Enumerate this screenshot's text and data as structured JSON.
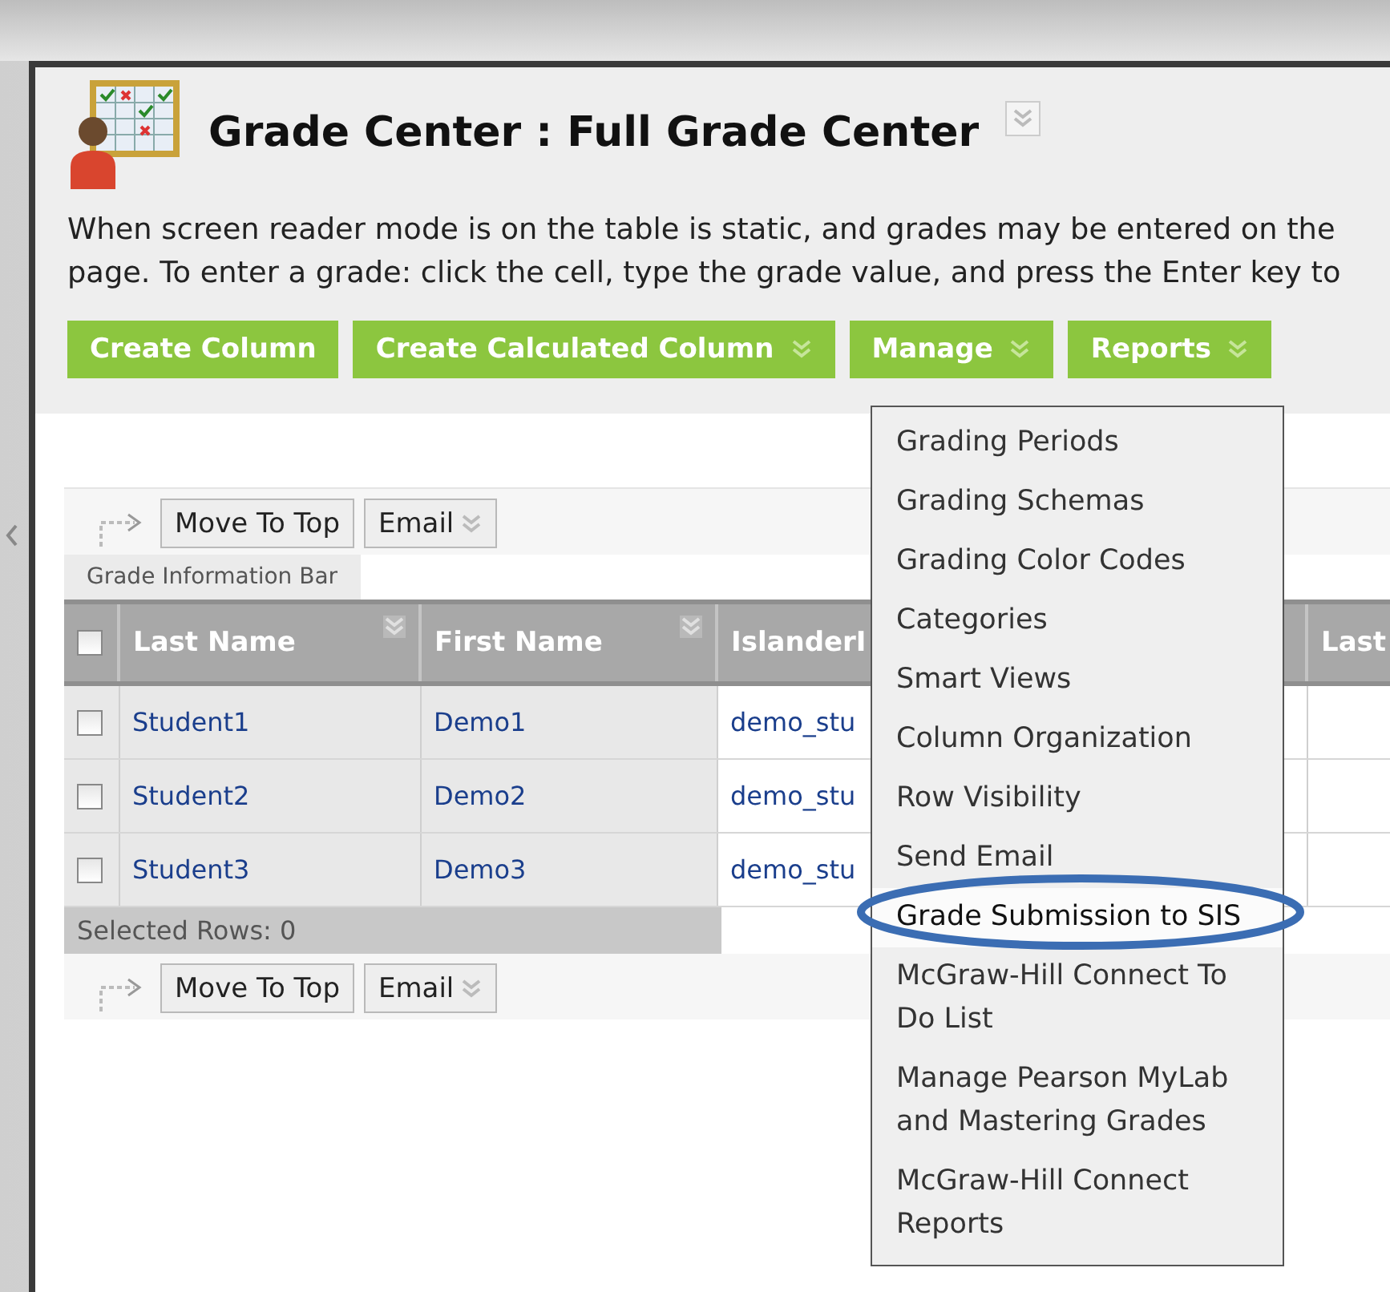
{
  "title": "Grade Center : Full Grade Center",
  "description": [
    "When screen reader mode is on the table is static, and grades may be entered on the",
    "page. To enter a grade: click the cell, type the grade value, and press the Enter key to"
  ],
  "action_buttons": [
    {
      "label": "Create Column",
      "has_menu": false
    },
    {
      "label": "Create Calculated Column",
      "has_menu": true
    },
    {
      "label": "Manage",
      "has_menu": true
    },
    {
      "label": "Reports",
      "has_menu": true
    }
  ],
  "top_actions": [
    {
      "label": "Move To Top",
      "has_menu": false
    },
    {
      "label": "Email",
      "has_menu": true
    }
  ],
  "info_bar": "Grade Information Bar",
  "table": {
    "select_all": {
      "checked": false
    },
    "columns": [
      {
        "label": "Last Name",
        "has_menu": true
      },
      {
        "label": "First Name",
        "has_menu": true
      },
      {
        "label": "IslanderI",
        "has_menu": false
      },
      {
        "label": "Last",
        "has_menu": false
      }
    ],
    "rows": [
      {
        "checked": false,
        "last_name": "Student1",
        "first_name": "Demo1",
        "islander_id": "demo_stu"
      },
      {
        "checked": false,
        "last_name": "Student2",
        "first_name": "Demo2",
        "islander_id": "demo_stu"
      },
      {
        "checked": false,
        "last_name": "Student3",
        "first_name": "Demo3",
        "islander_id": "demo_stu"
      }
    ]
  },
  "selected_rows": "Selected Rows: 0",
  "bottom_actions": [
    {
      "label": "Move To Top",
      "has_menu": false
    },
    {
      "label": "Email",
      "has_menu": true
    }
  ],
  "manage_menu": {
    "items": [
      {
        "label": "Grading Periods",
        "selected": false
      },
      {
        "label": "Grading Schemas",
        "selected": false
      },
      {
        "label": "Grading Color Codes",
        "selected": false
      },
      {
        "label": "Categories",
        "selected": false
      },
      {
        "label": "Smart Views",
        "selected": false
      },
      {
        "label": "Column Organization",
        "selected": false
      },
      {
        "label": "Row Visibility",
        "selected": false
      },
      {
        "label": "Send Email",
        "selected": false
      },
      {
        "label": "Grade Submission to SIS",
        "selected": true
      },
      {
        "label": "McGraw-Hill Connect To Do List",
        "selected": false
      },
      {
        "label": "Manage Pearson MyLab and Mastering Grades",
        "selected": false
      },
      {
        "label": "McGraw-Hill Connect Reports",
        "selected": false
      }
    ]
  }
}
